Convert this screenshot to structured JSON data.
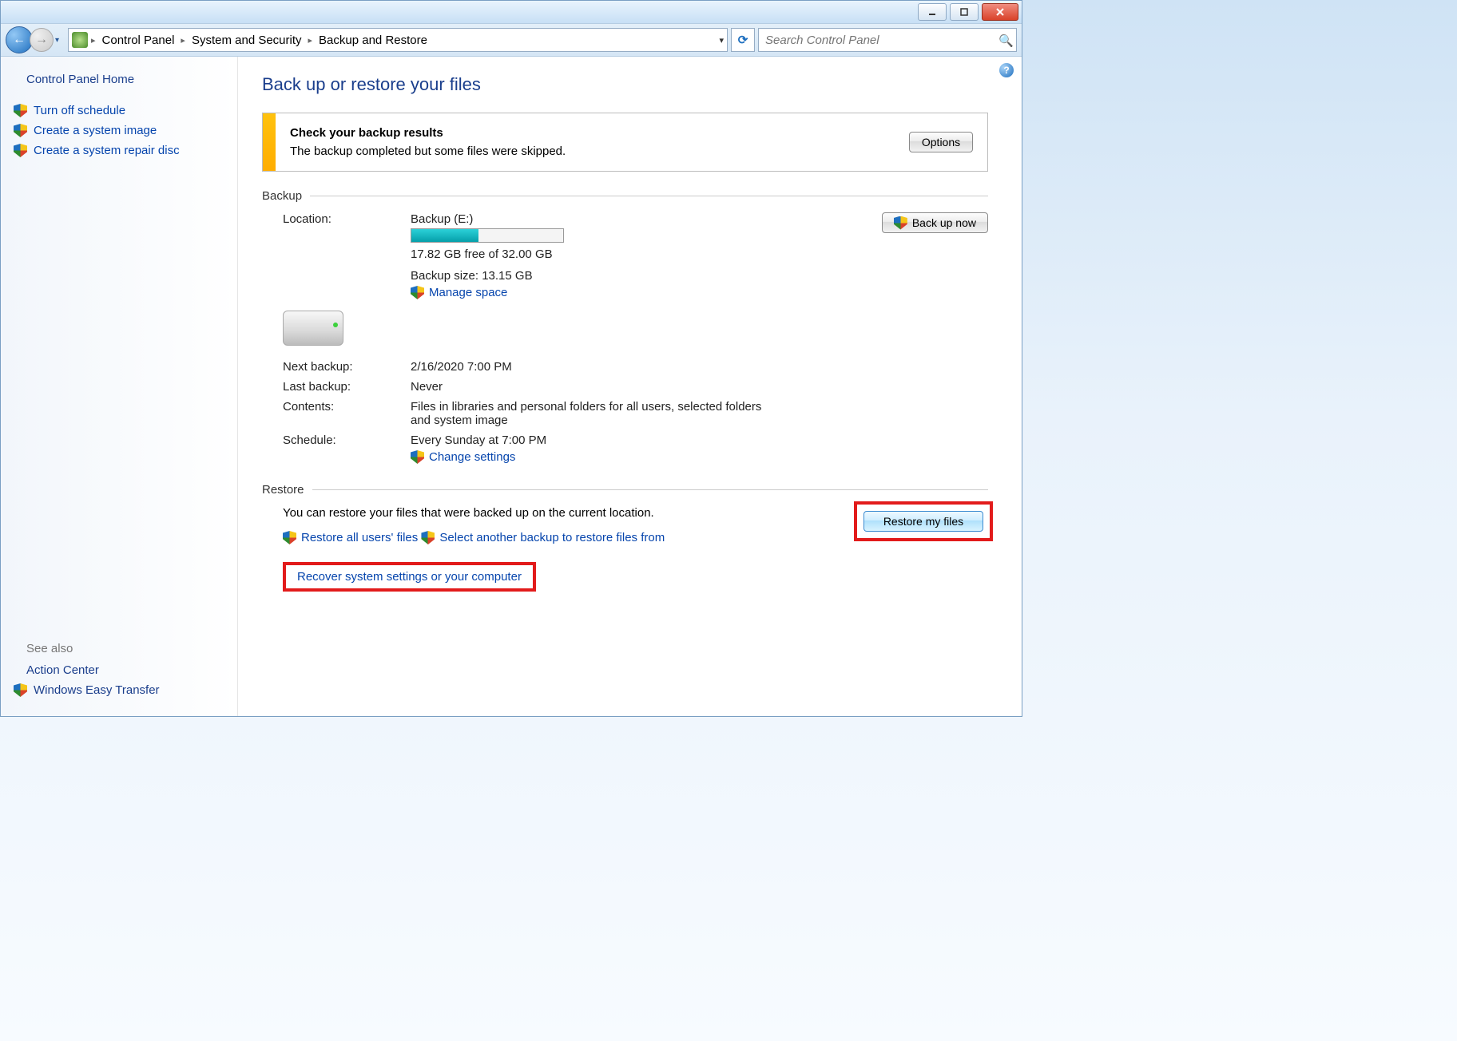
{
  "window": {
    "minimize_tip": "Minimize",
    "maximize_tip": "Maximize",
    "close_tip": "Close"
  },
  "breadcrumb": {
    "items": [
      "Control Panel",
      "System and Security",
      "Backup and Restore"
    ]
  },
  "search": {
    "placeholder": "Search Control Panel"
  },
  "sidebar": {
    "home": "Control Panel Home",
    "links": [
      "Turn off schedule",
      "Create a system image",
      "Create a system repair disc"
    ],
    "see_also_h": "See also",
    "see_also": [
      "Action Center",
      "Windows Easy Transfer"
    ]
  },
  "page": {
    "title": "Back up or restore your files",
    "notice": {
      "title": "Check your backup results",
      "text": "The backup completed but some files were skipped.",
      "button": "Options"
    },
    "backup": {
      "header": "Backup",
      "location_k": "Location:",
      "location_v": "Backup (E:)",
      "space": "17.82 GB free of 32.00 GB",
      "progress_pct": 44,
      "size": "Backup size: 13.15 GB",
      "manage": "Manage space",
      "next_k": "Next backup:",
      "next_v": "2/16/2020 7:00 PM",
      "last_k": "Last backup:",
      "last_v": "Never",
      "contents_k": "Contents:",
      "contents_v": "Files in libraries and personal folders for all users, selected folders and system image",
      "sched_k": "Schedule:",
      "sched_v": "Every Sunday at 7:00 PM",
      "change": "Change settings",
      "back_up_now": "Back up now"
    },
    "restore": {
      "header": "Restore",
      "text": "You can restore your files that were backed up on the current location.",
      "restore_all": "Restore all users' files",
      "select_another": "Select another backup to restore files from",
      "recover": "Recover system settings or your computer",
      "restore_btn": "Restore my files"
    }
  }
}
